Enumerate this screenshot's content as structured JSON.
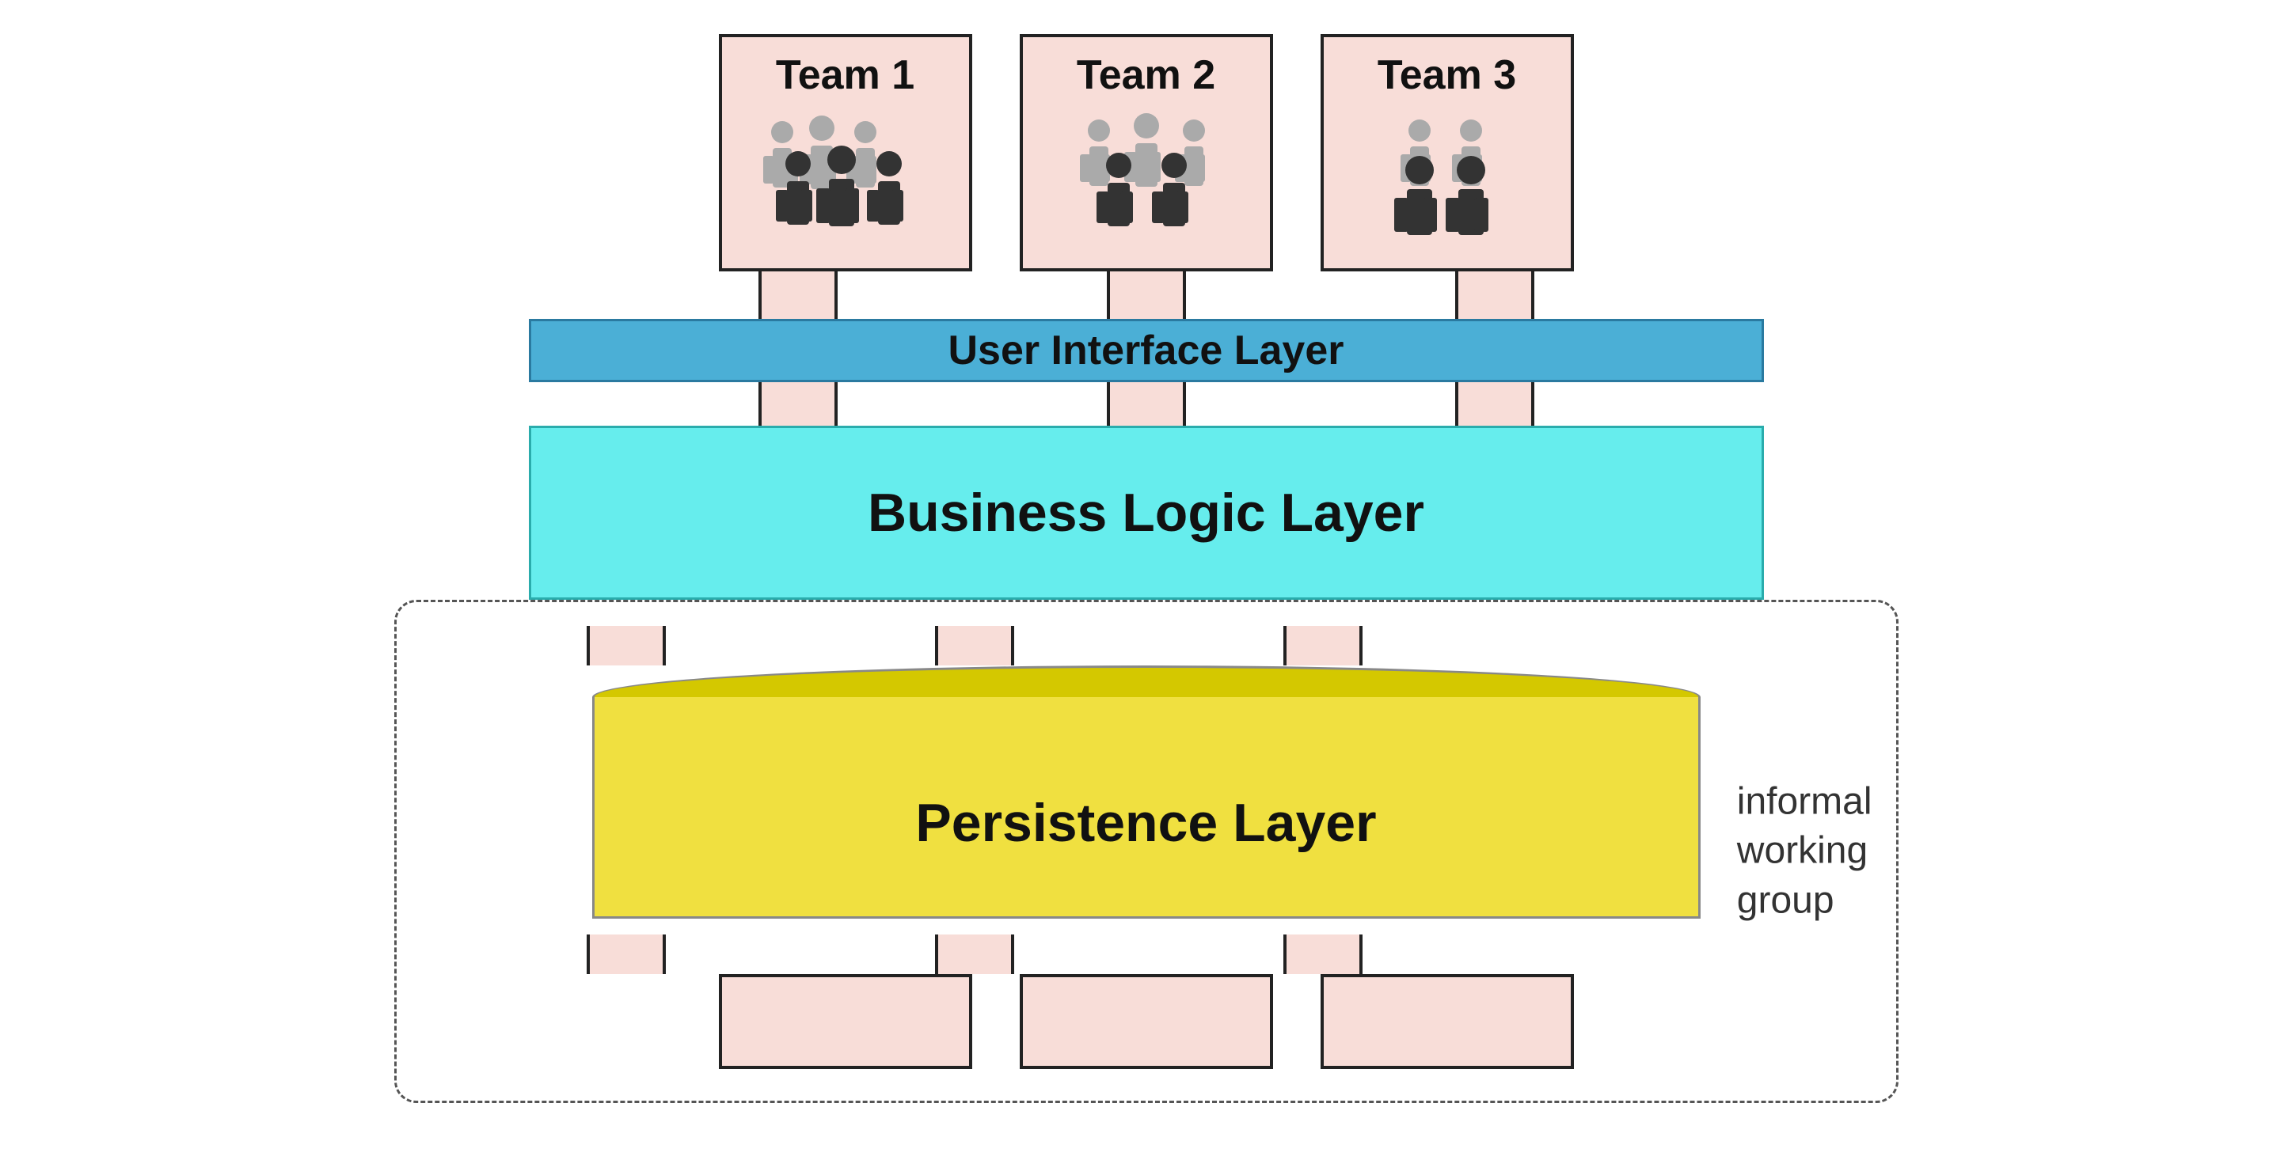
{
  "teams": [
    {
      "label": "Team 1",
      "id": "team-1"
    },
    {
      "label": "Team 2",
      "id": "team-2"
    },
    {
      "label": "Team 3",
      "id": "team-3"
    }
  ],
  "layers": {
    "ui": "User Interface Layer",
    "bll": "Business Logic Layer",
    "persistence": "Persistence Layer"
  },
  "informal_group": {
    "line1": "informal",
    "line2": "working",
    "line3": "group"
  },
  "colors": {
    "ui_bg": "#4bafd6",
    "bll_bg": "#66eded",
    "persistence_bg": "#f0e040",
    "persistence_top": "#d4c800",
    "team_bg": "#f8ddd8",
    "connector_bg": "#f8ddd8"
  }
}
